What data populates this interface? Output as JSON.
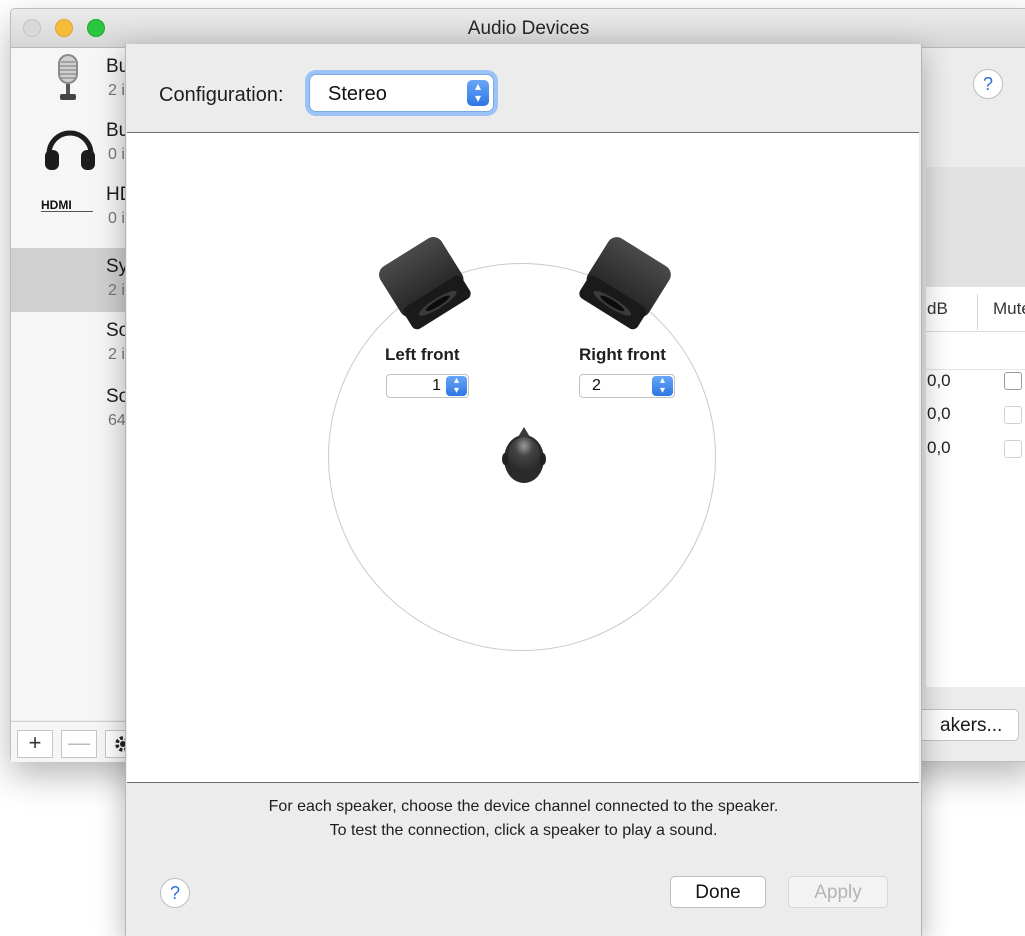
{
  "window": {
    "title": "Audio Devices"
  },
  "sidebar": {
    "devices": [
      {
        "icon": "microphone-icon",
        "name": "Bu",
        "sub": "2 i"
      },
      {
        "icon": "headphones-icon",
        "name": "Bu",
        "sub": "0 i"
      },
      {
        "icon": "hdmi-icon",
        "name": "HD",
        "sub": "0 i"
      },
      {
        "icon": "none",
        "name": "Sy",
        "sub": "2 i"
      },
      {
        "icon": "none",
        "name": "So",
        "sub": "2 i"
      },
      {
        "icon": "none",
        "name": "So",
        "sub": "64"
      }
    ],
    "toolbar": {
      "add": "+",
      "remove": "—"
    }
  },
  "back_panel": {
    "help": "?",
    "table_headers": {
      "db": "dB",
      "mute": "Mute"
    },
    "rows": [
      {
        "db": "0,0"
      },
      {
        "db": "0,0"
      },
      {
        "db": "0,0"
      }
    ],
    "speakers_button": "akers..."
  },
  "sheet": {
    "config_label": "Configuration:",
    "config_value": "Stereo",
    "left_front": {
      "label": "Left front",
      "channel": "1"
    },
    "right_front": {
      "label": "Right front",
      "channel": "2"
    },
    "instruction_line1": "For each speaker, choose the device channel connected to the speaker.",
    "instruction_line2": "To test the connection, click a speaker to play a sound.",
    "help": "?",
    "done": "Done",
    "apply": "Apply"
  },
  "colors": {
    "accent": "#2d76e4",
    "focus_ring": "#9cc3f5",
    "selection": "#d0d0d0"
  }
}
